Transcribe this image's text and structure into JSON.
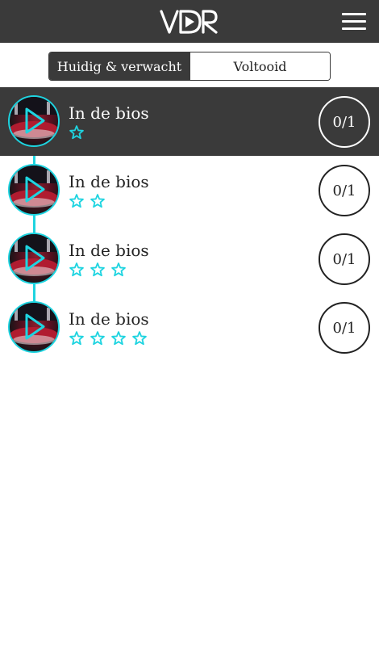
{
  "app": {
    "logo_text": "VDR"
  },
  "tabs": [
    {
      "label": "Huidig & verwacht",
      "active": true
    },
    {
      "label": "Voltooid",
      "active": false
    }
  ],
  "items": [
    {
      "title": "In de bios",
      "stars": 1,
      "progress": "0/1",
      "selected": true
    },
    {
      "title": "In de bios",
      "stars": 2,
      "progress": "0/1",
      "selected": false
    },
    {
      "title": "In de bios",
      "stars": 3,
      "progress": "0/1",
      "selected": false
    },
    {
      "title": "In de bios",
      "stars": 4,
      "progress": "0/1",
      "selected": false
    }
  ],
  "icons": {
    "menu": "hamburger-menu-icon",
    "play": "play-icon",
    "star": "star-outline-icon"
  },
  "colors": {
    "header_bg": "#3a3a3a",
    "accent": "#1ed4e0",
    "selected_row_bg": "#3a3a3a"
  }
}
